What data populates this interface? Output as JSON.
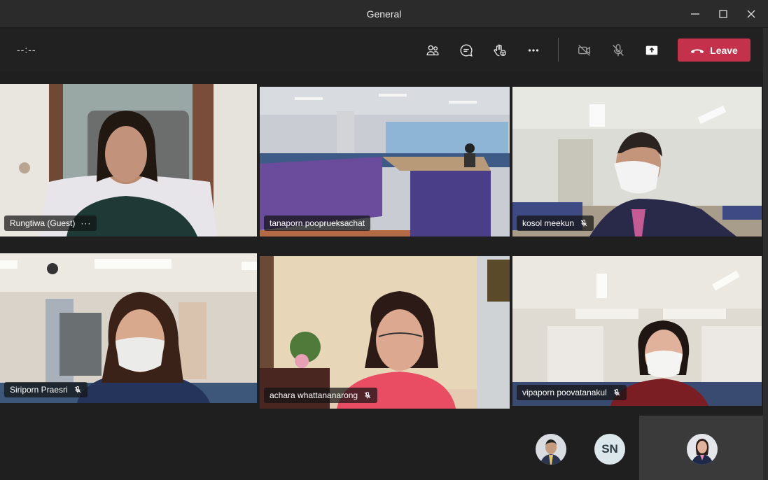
{
  "window": {
    "title": "General"
  },
  "toolbar": {
    "timer": "--:--",
    "buttons": [
      {
        "name": "participants-icon"
      },
      {
        "name": "chat-icon"
      },
      {
        "name": "raise-hand-icon"
      },
      {
        "name": "more-icon"
      },
      {
        "name": "camera-off-icon"
      },
      {
        "name": "mic-off-icon"
      },
      {
        "name": "share-icon"
      }
    ],
    "leave_label": "Leave"
  },
  "participants": [
    {
      "name": "Rungtiwa (Guest)",
      "muted": false,
      "more": "···"
    },
    {
      "name": "tanaporn pooprueksachat",
      "muted": false
    },
    {
      "name": "kosol meekun",
      "muted": true
    },
    {
      "name": "Siriporn Praesri",
      "muted": true
    },
    {
      "name": "achara whattananarong",
      "muted": true
    },
    {
      "name": "vipaporn poovatanakul",
      "muted": true
    }
  ],
  "bottom": {
    "avatars": [
      {
        "type": "photo",
        "name": "participant-avatar-1"
      },
      {
        "type": "initials",
        "initials": "SN"
      },
      {
        "type": "photo",
        "name": "self-avatar"
      }
    ]
  },
  "colors": {
    "leave": "#c4314b",
    "background": "#1f1f1f",
    "toolbar": "#212121"
  }
}
